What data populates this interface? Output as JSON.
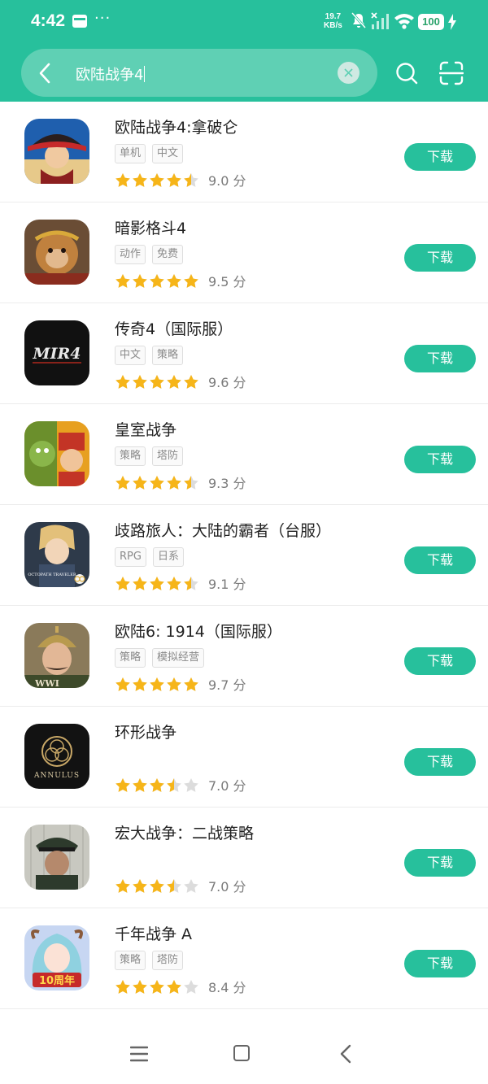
{
  "status_bar": {
    "time": "4:42",
    "dots": "···",
    "net_speed_value": "19.7",
    "net_speed_unit": "KB/s",
    "battery": "100"
  },
  "search": {
    "query": "欧陆战争4",
    "icons": [
      "back-arrow-icon",
      "clear-icon",
      "search-icon",
      "scan-icon"
    ]
  },
  "apps": [
    {
      "name": "欧陆战争4:拿破仑",
      "tags": [
        "单机",
        "中文"
      ],
      "stars": 4.5,
      "score": "9.0 分",
      "button": "下载"
    },
    {
      "name": "暗影格斗4",
      "tags": [
        "动作",
        "免费"
      ],
      "stars": 5,
      "score": "9.5 分",
      "button": "下载"
    },
    {
      "name": "传奇4（国际服）",
      "tags": [
        "中文",
        "策略"
      ],
      "stars": 5,
      "score": "9.6 分",
      "button": "下载"
    },
    {
      "name": "皇室战争",
      "tags": [
        "策略",
        "塔防"
      ],
      "stars": 4.5,
      "score": "9.3 分",
      "button": "下载"
    },
    {
      "name": "歧路旅人：大陆的霸者（台服）",
      "tags": [
        "RPG",
        "日系"
      ],
      "stars": 4.5,
      "score": "9.1 分",
      "button": "下载"
    },
    {
      "name": "欧陆6: 1914（国际服）",
      "tags": [
        "策略",
        "模拟经营"
      ],
      "stars": 5,
      "score": "9.7 分",
      "button": "下载"
    },
    {
      "name": "环形战争",
      "tags": [],
      "stars": 3.5,
      "score": "7.0 分",
      "button": "下载"
    },
    {
      "name": "宏大战争：二战策略",
      "tags": [],
      "stars": 3.5,
      "score": "7.0 分",
      "button": "下载"
    },
    {
      "name": "千年战争 A",
      "tags": [
        "策略",
        "塔防"
      ],
      "stars": 4,
      "score": "8.4 分",
      "button": "下载"
    }
  ],
  "icon_text": {
    "mir4": "MIR4",
    "annulus": "ANNULUS",
    "octopath": "OCTOPATH TRAVELER",
    "wwi": "WWI",
    "tenyears": "10周年"
  },
  "nav": {
    "icons": [
      "menu-icon",
      "home-icon",
      "back-icon"
    ]
  },
  "colors": {
    "accent": "#27c09c",
    "star": "#f6b519",
    "star_empty": "#dcdcdc"
  }
}
